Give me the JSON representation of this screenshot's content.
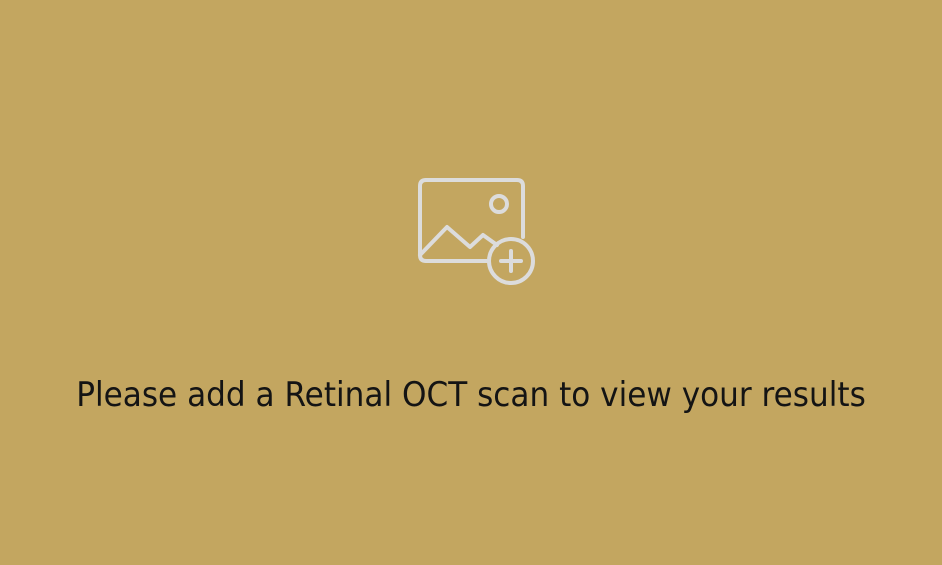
{
  "empty_state": {
    "icon": "add-image-icon",
    "message": "Please add a Retinal OCT scan to view your results"
  },
  "colors": {
    "background": "#c3a660",
    "icon": "#dcdcdc",
    "text": "#141414"
  }
}
